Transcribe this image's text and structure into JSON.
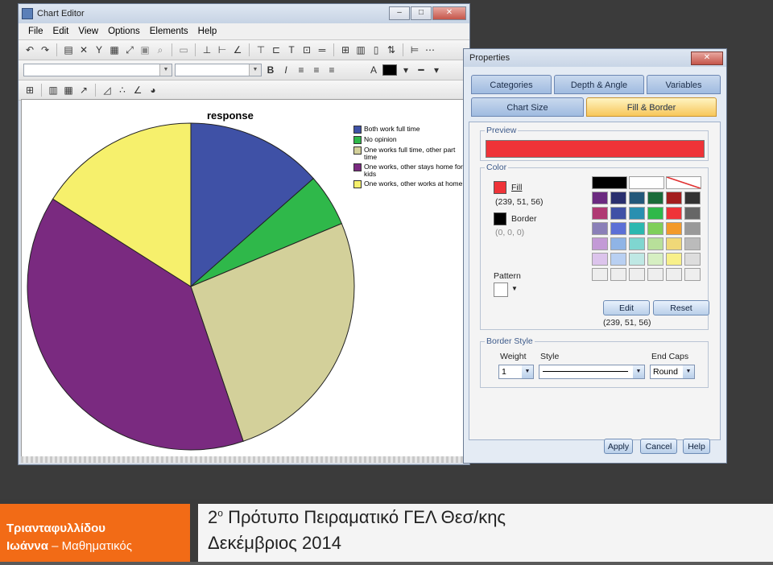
{
  "chart_editor": {
    "title": "Chart Editor",
    "menus": [
      "File",
      "Edit",
      "View",
      "Options",
      "Elements",
      "Help"
    ]
  },
  "chart_data": {
    "type": "pie",
    "title": "response",
    "legend_position": "top-right",
    "slices": [
      {
        "label": "Both work full time",
        "value": 13.5,
        "color": "#3f51a6"
      },
      {
        "label": "No opinion",
        "value": 5.2,
        "color": "#2fb84a"
      },
      {
        "label": "One works full time, other part time",
        "value": 26.1,
        "color": "#d3d09a"
      },
      {
        "label": "One works, other stays home for kids",
        "value": 39.2,
        "color": "#7a2a80"
      },
      {
        "label": "One works, other works at home",
        "value": 16.0,
        "color": "#f6f06c"
      }
    ]
  },
  "properties": {
    "title": "Properties",
    "tabs_row1": [
      "Categories",
      "Depth & Angle",
      "Variables"
    ],
    "tabs_row2": [
      "Chart Size",
      "Fill & Border"
    ],
    "preview_label": "Preview",
    "preview_color": "#ef3338",
    "color_label": "Color",
    "fill_label": "Fill",
    "fill_value": "(239, 51, 56)",
    "border_label": "Border",
    "border_value": "(0, 0, 0)",
    "pattern_label": "Pattern",
    "edit_label": "Edit",
    "reset_label": "Reset",
    "selected_value": "(239, 51, 56)",
    "border_style_label": "Border Style",
    "weight_label": "Weight",
    "weight_value": "1",
    "style_label": "Style",
    "end_caps_label": "End Caps",
    "end_caps_value": "Round",
    "apply_label": "Apply",
    "cancel_label": "Cancel",
    "help_label": "Help",
    "palette": [
      "#000000",
      "#ffffff",
      "none",
      "",
      "",
      "",
      "#6b2a80",
      "#2a2f6e",
      "#23587a",
      "#1a6b3a",
      "#a41e1e",
      "#333333",
      "#b03a73",
      "#3f51a6",
      "#2a8fb0",
      "#2fb84a",
      "#ef3338",
      "#666666",
      "#8a7fb8",
      "#5b6fd6",
      "#2cb8b0",
      "#7fcf5a",
      "#f39a2a",
      "#999999",
      "#c39ad6",
      "#8fb4e6",
      "#7fd6d0",
      "#b8e09a",
      "#f0d878",
      "#bbbbbb",
      "#dcc4ec",
      "#b9d0f2",
      "#bfe8e4",
      "#d6efc2",
      "#f8f08a",
      "#dddddd",
      "#eeeeee",
      "#eeeeee",
      "#eeeeee",
      "#eeeeee",
      "#eeeeee",
      "#eeeeee"
    ]
  },
  "footer": {
    "author_name": "Τριανταφυλλίδου",
    "author_first": "Ιωάννα",
    "author_role": "Μαθηματικός",
    "school_superscript": "ο",
    "school_number": "2",
    "school": "Πρότυπο Πειραματικό ΓΕΛ Θεσ/κης",
    "date": "Δεκέμβριος 2014"
  }
}
